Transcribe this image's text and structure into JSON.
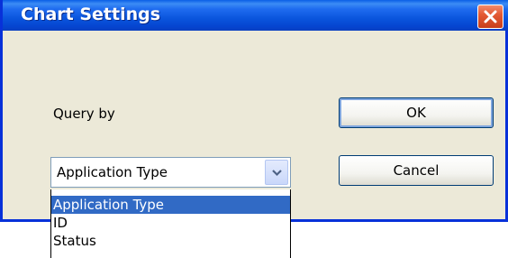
{
  "dialog": {
    "title": "Chart Settings",
    "query_label": "Query by",
    "ok_label": "OK",
    "cancel_label": "Cancel",
    "close_icon": "close-icon"
  },
  "combo": {
    "selected": "Application Type",
    "options": [
      "Application Type",
      "ID",
      "Status"
    ],
    "highlighted": "Application Type"
  },
  "colors": {
    "titlebar": "#0A55DD",
    "window_border": "#0831D9",
    "dialog_bg": "#ECE9D8",
    "selection": "#316AC5",
    "close_button": "#E45A34"
  }
}
